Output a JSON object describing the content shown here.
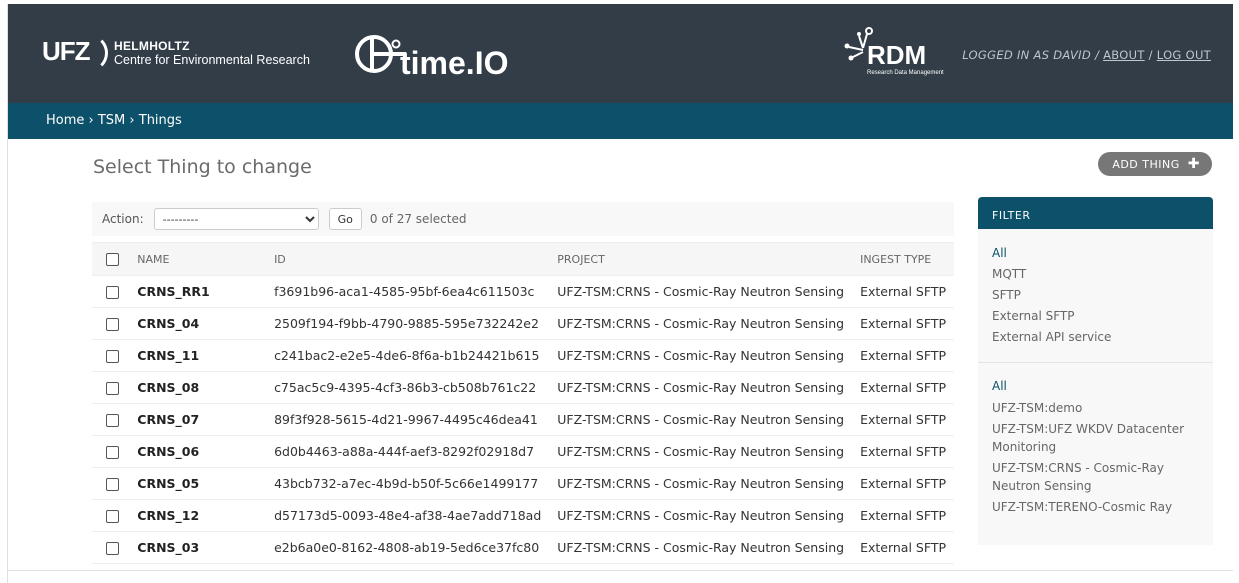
{
  "header": {
    "ufz_mark": "UFZ",
    "ufz_line1": "HELMHOLTZ",
    "ufz_line2": "Centre for Environmental Research",
    "timeio_word": "time.IO",
    "rdm_word": "RDM",
    "rdm_sub": "Research Data Management",
    "logged_in": "LOGGED IN AS DAVID",
    "about": "ABOUT",
    "logout": "LOG OUT",
    "sep": " / "
  },
  "breadcrumbs": {
    "home": "Home",
    "tsm": "TSM",
    "things": "Things",
    "sep": " › "
  },
  "page": {
    "title": "Select Thing to change",
    "add_button": "ADD THING"
  },
  "actions": {
    "label": "Action:",
    "selected_option": "---------",
    "go": "Go",
    "count": "0 of 27 selected"
  },
  "table": {
    "headers": [
      "NAME",
      "ID",
      "PROJECT",
      "INGEST TYPE"
    ],
    "rows": [
      {
        "name": "CRNS_RR1",
        "id": "f3691b96-aca1-4585-95bf-6ea4c611503c",
        "project": "UFZ-TSM:CRNS - Cosmic-Ray Neutron Sensing",
        "ingest": "External SFTP"
      },
      {
        "name": "CRNS_04",
        "id": "2509f194-f9bb-4790-9885-595e732242e2",
        "project": "UFZ-TSM:CRNS - Cosmic-Ray Neutron Sensing",
        "ingest": "External SFTP"
      },
      {
        "name": "CRNS_11",
        "id": "c241bac2-e2e5-4de6-8f6a-b1b24421b615",
        "project": "UFZ-TSM:CRNS - Cosmic-Ray Neutron Sensing",
        "ingest": "External SFTP"
      },
      {
        "name": "CRNS_08",
        "id": "c75ac5c9-4395-4cf3-86b3-cb508b761c22",
        "project": "UFZ-TSM:CRNS - Cosmic-Ray Neutron Sensing",
        "ingest": "External SFTP"
      },
      {
        "name": "CRNS_07",
        "id": "89f3f928-5615-4d21-9967-4495c46dea41",
        "project": "UFZ-TSM:CRNS - Cosmic-Ray Neutron Sensing",
        "ingest": "External SFTP"
      },
      {
        "name": "CRNS_06",
        "id": "6d0b4463-a88a-444f-aef3-8292f02918d7",
        "project": "UFZ-TSM:CRNS - Cosmic-Ray Neutron Sensing",
        "ingest": "External SFTP"
      },
      {
        "name": "CRNS_05",
        "id": "43bcb732-a7ec-4b9d-b50f-5c66e1499177",
        "project": "UFZ-TSM:CRNS - Cosmic-Ray Neutron Sensing",
        "ingest": "External SFTP"
      },
      {
        "name": "CRNS_12",
        "id": "d57173d5-0093-48e4-af38-4ae7add718ad",
        "project": "UFZ-TSM:CRNS - Cosmic-Ray Neutron Sensing",
        "ingest": "External SFTP"
      },
      {
        "name": "CRNS_03",
        "id": "e2b6a0e0-8162-4808-ab19-5ed6ce37fc80",
        "project": "UFZ-TSM:CRNS - Cosmic-Ray Neutron Sensing",
        "ingest": "External SFTP"
      }
    ]
  },
  "filter": {
    "title": "FILTER",
    "ingest_options": [
      "All",
      "MQTT",
      "SFTP",
      "External SFTP",
      "External API service"
    ],
    "project_options": [
      "All",
      "UFZ-TSM:demo",
      "UFZ-TSM:UFZ WKDV Datacenter Monitoring",
      "UFZ-TSM:CRNS - Cosmic-Ray Neutron Sensing",
      "UFZ-TSM:TERENO-Cosmic Ray"
    ]
  },
  "colors": {
    "header_bg": "#323d48",
    "breadcrumb_bg": "#0c5169",
    "button_bg": "#777777"
  }
}
